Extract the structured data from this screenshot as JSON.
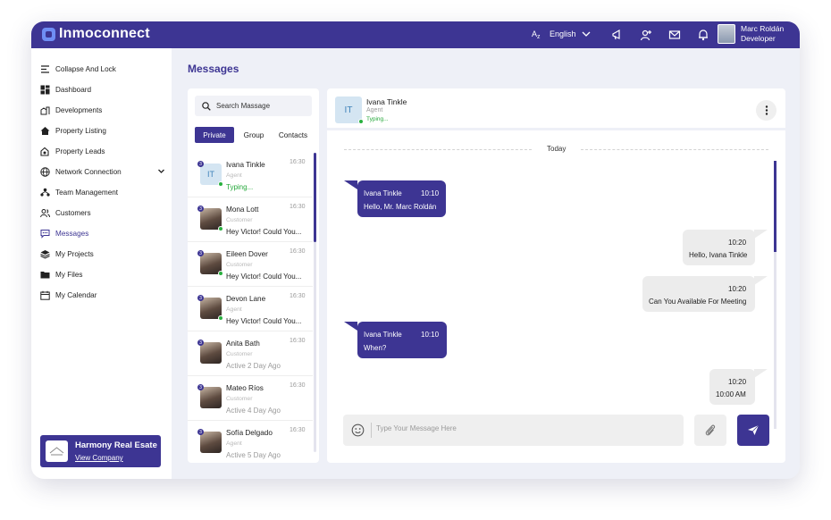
{
  "app": {
    "name": "Inmoconnect"
  },
  "header": {
    "language": "English",
    "user_name": "Marc Roldán",
    "user_role": "Developer",
    "icons": [
      "megaphone-icon",
      "add-user-icon",
      "mail-icon",
      "bell-icon"
    ]
  },
  "sidebar": {
    "items": [
      {
        "label": "Collapse And Lock",
        "icon": "collapse-icon"
      },
      {
        "label": "Dashboard",
        "icon": "dashboard-icon"
      },
      {
        "label": "Developments",
        "icon": "buildings-icon"
      },
      {
        "label": "Property Listing",
        "icon": "house-icon"
      },
      {
        "label": "Property Leads",
        "icon": "leads-icon"
      },
      {
        "label": "Network Connection",
        "icon": "globe-icon"
      },
      {
        "label": "Team Management",
        "icon": "team-icon"
      },
      {
        "label": "Customers",
        "icon": "customers-icon"
      },
      {
        "label": "Messages",
        "icon": "chat-icon"
      },
      {
        "label": "My Projects",
        "icon": "layers-icon"
      },
      {
        "label": "My Files",
        "icon": "folder-icon"
      },
      {
        "label": "My Calendar",
        "icon": "calendar-icon"
      }
    ],
    "active": "Messages",
    "company": {
      "name": "Harmony Real Esate",
      "link": "View Company"
    }
  },
  "page": {
    "title": "Messages"
  },
  "list": {
    "search_placeholder": "Search Massage",
    "tabs": [
      "Private",
      "Group",
      "Contacts"
    ],
    "active_tab": "Private",
    "contacts": [
      {
        "name": "Ivana Tinkle",
        "role": "Agent",
        "message": "Typing...",
        "time": "16:30",
        "initials": "IT",
        "badge": "3",
        "online": true,
        "status": "typing"
      },
      {
        "name": "Mona Lott",
        "role": "Customer",
        "message": "Hey Victor! Could You...",
        "time": "16:30",
        "badge": "3",
        "online": true,
        "status": "message"
      },
      {
        "name": "Eileen Dover",
        "role": "Customer",
        "message": "Hey Victor! Could You...",
        "time": "16:30",
        "badge": "3",
        "online": true,
        "status": "message"
      },
      {
        "name": "Devon Lane",
        "role": "Agent",
        "message": "Hey Victor! Could You...",
        "time": "16:30",
        "badge": "3",
        "online": true,
        "status": "message"
      },
      {
        "name": "Anita Bath",
        "role": "Customer",
        "message": "Active 2 Day Ago",
        "time": "16:30",
        "badge": "3",
        "online": false,
        "status": "inactive"
      },
      {
        "name": "Mateo Ríos",
        "role": "Customer",
        "message": "Active 4 Day Ago",
        "time": "16:30",
        "badge": "3",
        "online": false,
        "status": "inactive"
      },
      {
        "name": "Sofía Delgado",
        "role": "Agent",
        "message": "Active 5 Day Ago",
        "time": "16:30",
        "badge": "3",
        "online": false,
        "status": "inactive"
      }
    ]
  },
  "chat": {
    "contact": {
      "name": "Ivana Tinkle",
      "role": "Agent",
      "status": "Typing...",
      "initials": "IT"
    },
    "date_label": "Today",
    "messages": [
      {
        "direction": "in",
        "sender": "Ivana Tinkle",
        "time": "10:10",
        "text": "Hello, Mr. Marc Roldán"
      },
      {
        "direction": "out",
        "time": "10:20",
        "text": "Hello, Ivana Tinkle"
      },
      {
        "direction": "out",
        "time": "10:20",
        "text": "Can You Available For Meeting"
      },
      {
        "direction": "in",
        "sender": "Ivana Tinkle",
        "time": "10:10",
        "text": "When?"
      },
      {
        "direction": "out",
        "time": "10:20",
        "text": "10:00 AM"
      }
    ],
    "composer_placeholder": "Type Your Message Here"
  },
  "colors": {
    "primary": "#3d3593",
    "online": "#28b03f",
    "background": "#eef0f7"
  }
}
